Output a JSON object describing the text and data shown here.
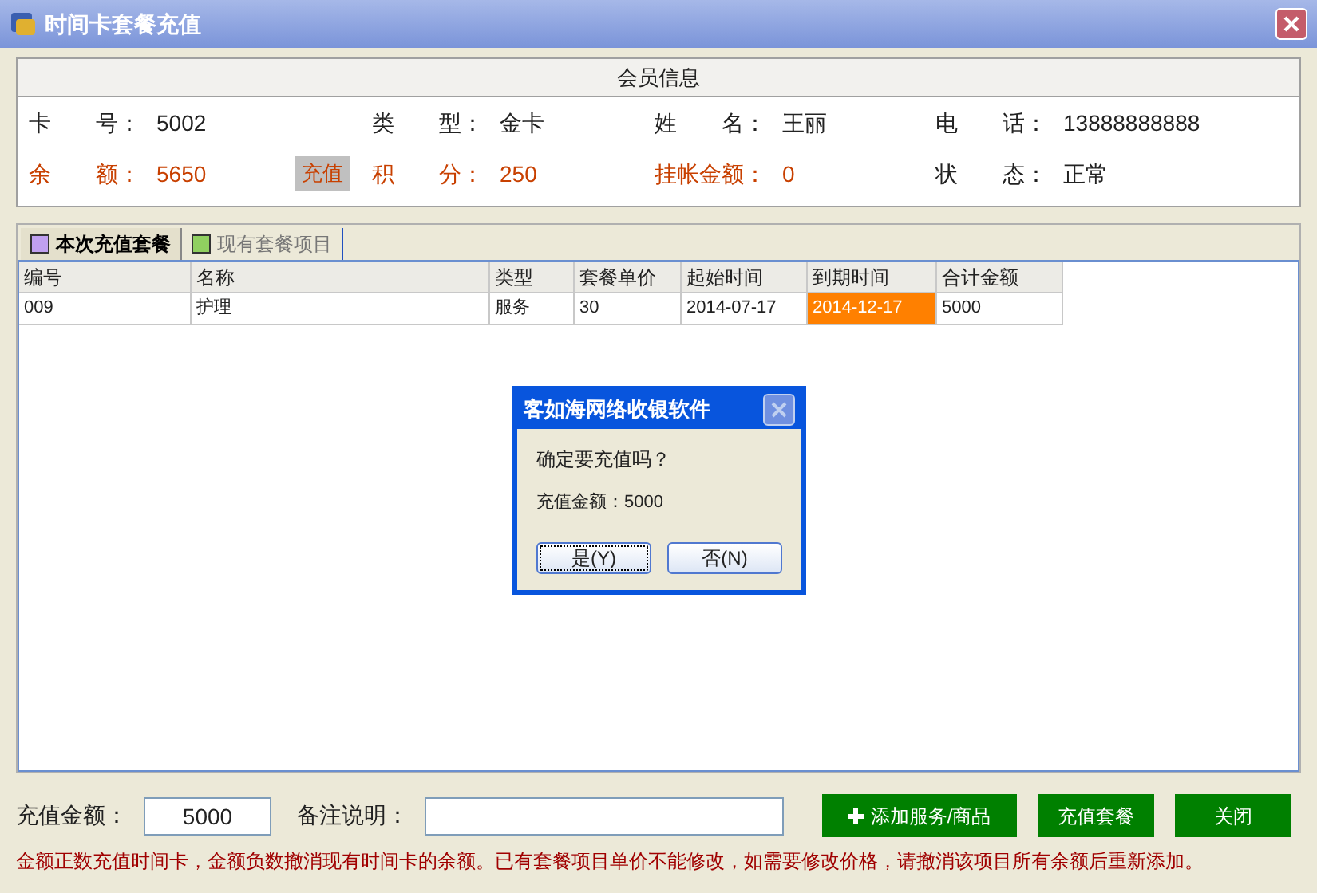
{
  "window": {
    "title": "时间卡套餐充值"
  },
  "member_info": {
    "title": "会员信息",
    "rows": [
      [
        {
          "label": "卡　　号：",
          "value": "5002",
          "emphasis": false
        },
        {
          "label": "类　　型：",
          "value": "金卡",
          "emphasis": false
        },
        {
          "label": "姓　　名：",
          "value": "王丽",
          "emphasis": false
        },
        {
          "label": "电　　话：",
          "value": "13888888888",
          "emphasis": false
        }
      ],
      [
        {
          "label": "余　　额：",
          "value": "5650",
          "emphasis": true,
          "button": "充值"
        },
        {
          "label": "积　　分：",
          "value": "250",
          "emphasis": true
        },
        {
          "label": "挂帐金额：",
          "value": "0",
          "emphasis": true
        },
        {
          "label": "状　　态：",
          "value": "正常",
          "emphasis": false
        }
      ]
    ]
  },
  "tabs": [
    {
      "label": "本次充值套餐",
      "selected": true,
      "color": "#c0a0f0"
    },
    {
      "label": "现有套餐项目",
      "selected": false,
      "color": "#90d060"
    }
  ],
  "table": {
    "columns": [
      "编号",
      "名称",
      "类型",
      "套餐单价",
      "起始时间",
      "到期时间",
      "合计金额"
    ],
    "rows": [
      [
        {
          "text": "009",
          "highlighted": false
        },
        {
          "text": "护理",
          "highlighted": false
        },
        {
          "text": "服务",
          "highlighted": false
        },
        {
          "text": "30",
          "highlighted": false
        },
        {
          "text": "2014-07-17",
          "highlighted": false
        },
        {
          "text": "2014-12-17",
          "highlighted": true
        },
        {
          "text": "5000",
          "highlighted": false
        }
      ]
    ]
  },
  "dialog": {
    "title": "客如海网络收银软件",
    "message": "确定要充值吗？",
    "detail": "充值金额：5000",
    "buttons": [
      {
        "label": "是(Y)",
        "selected": true
      },
      {
        "label": "否(N)",
        "selected": false
      }
    ]
  },
  "form": {
    "amount_label": "充值金额：",
    "amount_value": "5000",
    "note_label": "备注说明："
  },
  "buttons": [
    {
      "label": "添加服务/商品",
      "kind": "add"
    },
    {
      "label": "充值套餐",
      "kind": "plain"
    },
    {
      "label": "关闭",
      "kind": "plain"
    }
  ],
  "note": "金额正数充值时间卡，金额负数撤消现有时间卡的余额。已有套餐项目单价不能修改，如需要修改价格，请撤消该项目所有余额后重新添加。"
}
